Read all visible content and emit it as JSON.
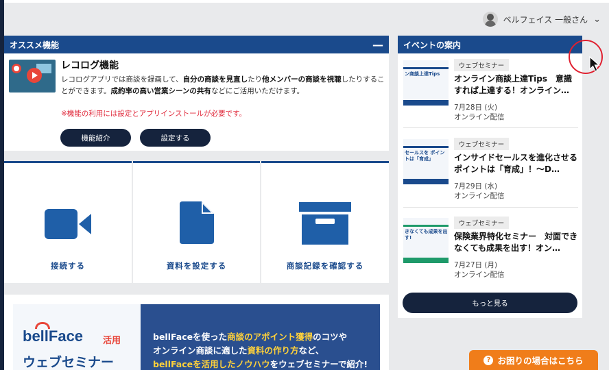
{
  "header": {
    "user_name": "ベルフェイス 一般さん",
    "dropdown_glyph": "⌄"
  },
  "recommended": {
    "panel_title": "オススメ機能",
    "collapse_glyph": "—",
    "feature_title": "レコログ機能",
    "desc_part1": "レコログアプリでは商談を録画して、",
    "desc_bold1": "自分の商談を見直し",
    "desc_part2": "たり",
    "desc_bold2": "他メンバーの商談を視聴",
    "desc_part3": "したりすることができます。",
    "desc_bold3": "成約率の高い営業シーンの共有",
    "desc_part4": "などにご活用いただけます。",
    "note": "※機能の利用には設定とアプリインストールが必要です。",
    "btn_intro": "機能紹介",
    "btn_setup": "設定する"
  },
  "tiles": [
    {
      "label": "接続する",
      "icon": "video-camera-icon"
    },
    {
      "label": "資料を設定する",
      "icon": "document-icon"
    },
    {
      "label": "商談記録を確認する",
      "icon": "archive-box-icon"
    }
  ],
  "banner": {
    "logo": "bellFace",
    "logo_accent": "活用",
    "subtitle": "ウェブセミナー",
    "line1_a": "bellFaceを使った",
    "line1_b": "商談のアポイント獲得",
    "line1_c": "のコツや",
    "line2_a": "オンライン商談に適した",
    "line2_b": "資料の作り方",
    "line2_c": "など、",
    "line3_a": "bellFaceを活用したノウハウ",
    "line3_b": "をウェブセミナーで紹介!"
  },
  "events": {
    "panel_title": "イベントの案内",
    "items": [
      {
        "tag": "ウェブセミナー",
        "title": "オンライン商談上達Tips　意識すれば上達する！オンライン…",
        "date": "7月28日 (火)",
        "place": "オンライン配信",
        "thumb_text": "ン商談上達Tips"
      },
      {
        "tag": "ウェブセミナー",
        "title": "インサイドセールスを進化させるポイントは「育成」！〜D…",
        "date": "7月29日 (水)",
        "place": "オンライン配信",
        "thumb_text": "セールスを ポイントは「育成」"
      },
      {
        "tag": "ウェブセミナー",
        "title": "保険業界特化セミナー　対面できなくても成果を出す！オン…",
        "date": "7月27日 (月)",
        "place": "オンライン配信",
        "thumb_text": "きなくても成果を出す!"
      }
    ],
    "more_label": "もっと見る"
  },
  "help": {
    "label": "お困りの場合はこちら",
    "icon_glyph": "?"
  },
  "colors": {
    "primary_navy": "#15233d",
    "header_blue": "#1a4a8c",
    "note_red": "#e0283a",
    "help_orange": "#f07d1a"
  }
}
